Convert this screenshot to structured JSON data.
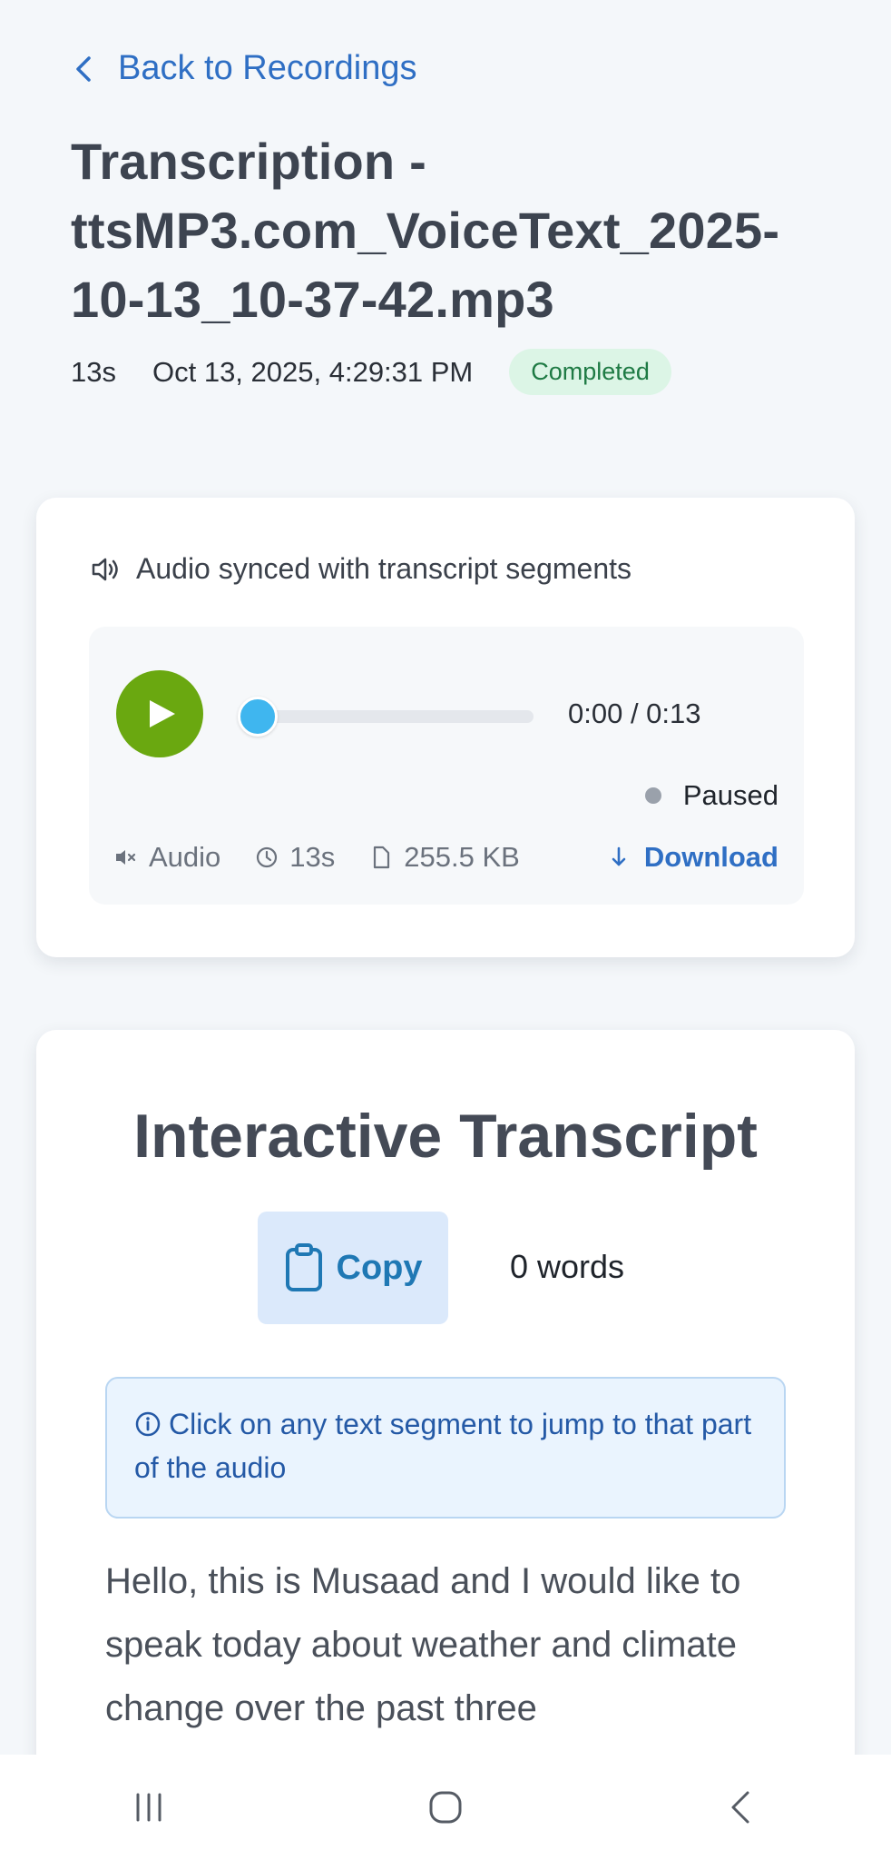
{
  "back_link": {
    "label": "Back to Recordings"
  },
  "title": "Transcription - ttsMP3.com_VoiceText_2025-10-13_10-37-42.mp3",
  "meta": {
    "duration": "13s",
    "date": "Oct 13, 2025, 4:29:31 PM",
    "status_badge": "Completed"
  },
  "audio": {
    "sync_text": "Audio synced with transcript segments",
    "time_display": "0:00 / 0:13",
    "progress_fraction": 0,
    "play_state": "Paused",
    "type_label": "Audio",
    "duration": "13s",
    "file_size": "255.5 KB",
    "download_label": "Download",
    "play_color": "#6aa810",
    "thumb_color": "#3fb6ef"
  },
  "transcript": {
    "heading": "Interactive Transcript",
    "copy_label": "Copy",
    "word_count": "0 words",
    "hint": "Click on any text segment to jump to that part of the audio",
    "text": "Hello, this is Musaad and I would like to speak today about weather and climate change over the past three"
  },
  "icons": {
    "back": "chevron-left-icon",
    "speaker": "speaker-icon",
    "play": "play-icon",
    "mute": "speaker-muted-icon",
    "clock": "clock-icon",
    "file": "file-icon",
    "download": "arrow-down-icon",
    "copy": "clipboard-icon",
    "info": "info-icon",
    "nav_recent": "recent-apps-icon",
    "nav_home": "home-icon",
    "nav_back": "back-icon"
  }
}
